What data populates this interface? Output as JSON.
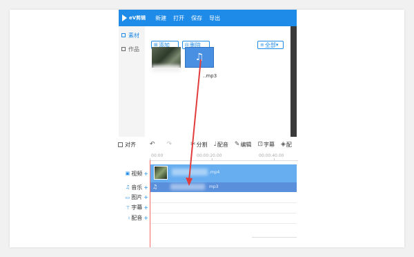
{
  "header": {
    "logo": "eV剪辑",
    "menu": [
      "新建",
      "打开",
      "保存",
      "导出"
    ]
  },
  "sidebar": {
    "items": [
      {
        "label": "素材",
        "icon": "grid-icon",
        "active": true
      },
      {
        "label": "作品",
        "icon": "folder-icon",
        "active": false
      }
    ]
  },
  "media": {
    "add_label": "添加",
    "delete_label": "删除",
    "filter_label": "全部",
    "items": [
      {
        "type": "video",
        "label": ""
      },
      {
        "type": "audio",
        "label": "..mp3",
        "icon": "music-note-icon"
      }
    ]
  },
  "toolbar": {
    "align_label": "对齐",
    "split_label": "分割",
    "dub_label": "配音",
    "edit_label": "编辑",
    "subtitle_label": "字幕",
    "more_label": "配"
  },
  "ruler": {
    "labels": [
      "00:00",
      "00:00:20.00",
      "00:00:40.00"
    ]
  },
  "timeline": {
    "tracks": [
      {
        "label": "视频",
        "icon": "video-icon"
      },
      {
        "label": "音乐",
        "icon": "music-icon"
      },
      {
        "label": "图片",
        "icon": "image-icon"
      },
      {
        "label": "字幕",
        "icon": "text-icon"
      },
      {
        "label": "配音",
        "icon": "mic-icon"
      }
    ],
    "video_clip_name": ".mp4",
    "audio_clip_name": "mp3"
  },
  "colors": {
    "accent": "#1f8be8",
    "annotation_arrow": "#e23b3b"
  }
}
